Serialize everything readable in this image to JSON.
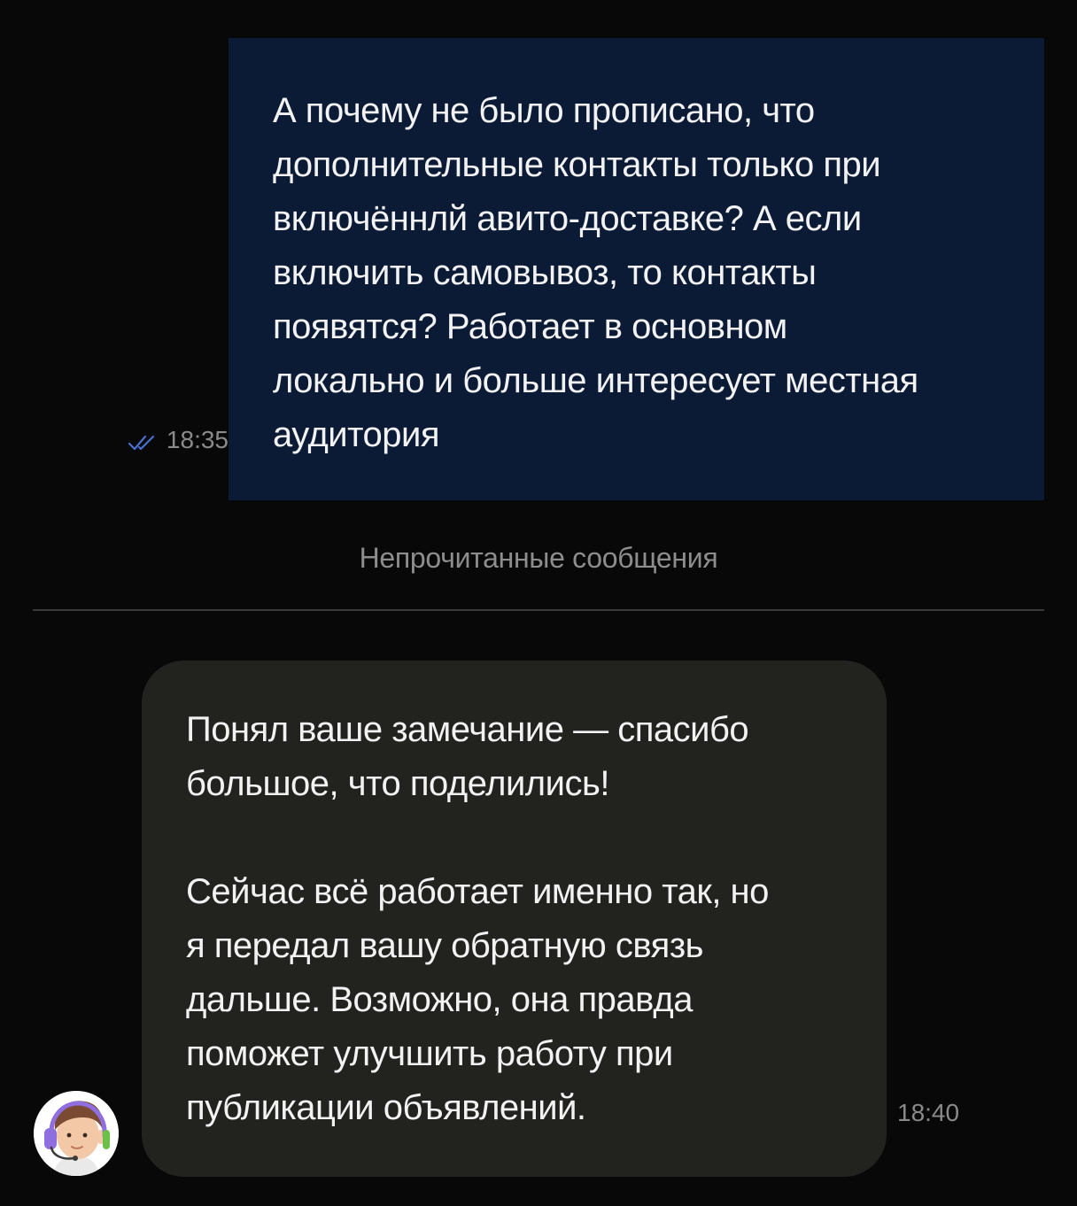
{
  "outgoing_message": {
    "text": "А почему не было прописано, что\nдополнительные контакты только при\nвключённлй авито-доставке? А если\nвключить самовывоз, то контакты\nпоявятся? Работает в основном\nлокально и больше интересует местная\nаудитория",
    "time": "18:35",
    "status_icon": "double-check-icon",
    "bubble_color": "#0b1b36"
  },
  "unread_divider": {
    "label": "Непрочитанные сообщения"
  },
  "incoming_message": {
    "text": "Понял ваше замечание — спасибо\nбольшое, что поделились!\n\nСейчас всё работает именно так, но\nя передал вашу обратную связь\nдальше. Возможно, она правда\nпоможет улучшить работу при\nпубликации объявлений.",
    "time": "18:40",
    "avatar_icon": "support-agent-avatar",
    "bubble_color": "#22231f"
  },
  "colors": {
    "background": "#080808",
    "text": "#f2f2f2",
    "meta_text": "#8a8a8a",
    "check_color": "#4a6fd1"
  }
}
